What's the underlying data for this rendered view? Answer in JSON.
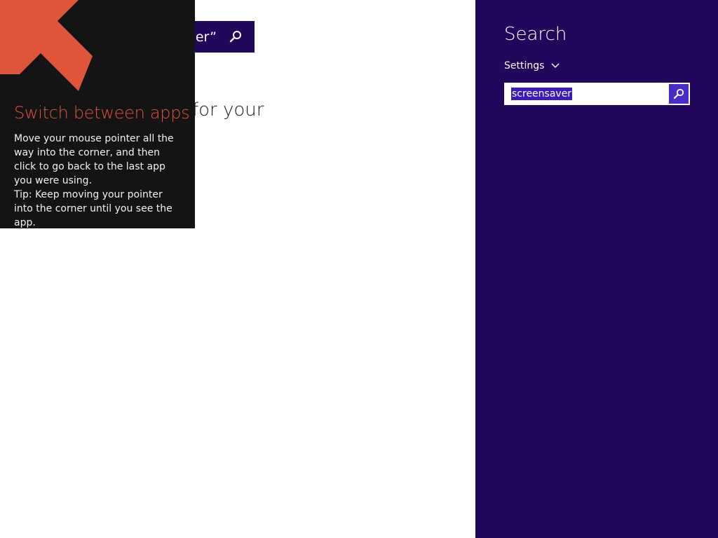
{
  "background_app": {
    "search_bar_text": "er”",
    "heading_fragment": "for your"
  },
  "tutorial_tip": {
    "title": "Switch between apps",
    "body_lines": [
      "Move your mouse pointer all the way into the corner, and then click to go back to the last app you were using.",
      "Tip: Keep moving your pointer into the corner until you see the app."
    ],
    "arrow_icon": "arrow-up-left-icon",
    "accent_color": "#e0553a"
  },
  "search_charm": {
    "title": "Search",
    "scope_label": "Settings",
    "scope_icon": "chevron-down-icon",
    "query_value": "screensaver",
    "search_button_icon": "search-icon",
    "background_color": "#23075c"
  }
}
